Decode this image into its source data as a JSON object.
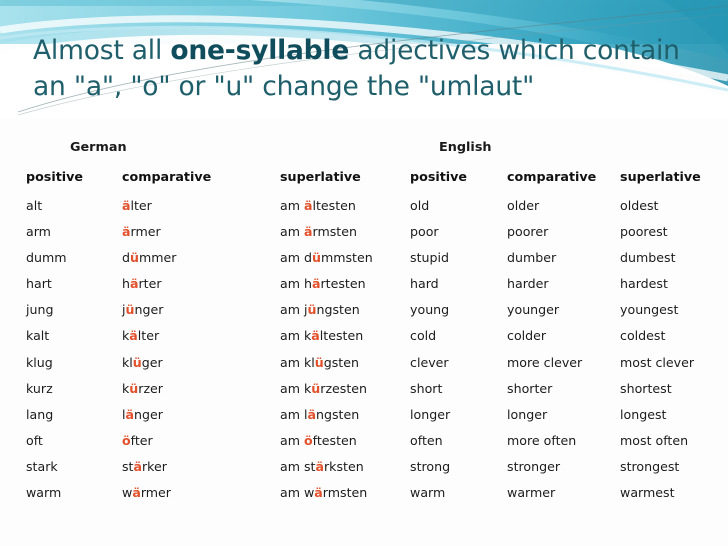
{
  "slide": {
    "title": {
      "line1_before": "Almost all ",
      "line1_strong": "one-syllable",
      "line1_after": " adjectives which contain",
      "line2": "an \"a\", \"o\" or \"u\" change the \"umlaut\""
    },
    "accent_color": "#1f5f6b",
    "umlaut_highlight_color": "#e2512b",
    "banner_colors": {
      "cyan_light": "#a8e1ec",
      "cyan_mid": "#5fc3d8",
      "teal": "#2e9fba",
      "white": "#ffffff"
    }
  },
  "table": {
    "group_headers": {
      "german": "German",
      "english": "English"
    },
    "columns": [
      "positive",
      "comparative",
      "superlative",
      "positive",
      "comparative",
      "superlative"
    ],
    "rows": [
      {
        "de_positive": "alt",
        "de_comparative": {
          "pre": "",
          "um": "ä",
          "post": "lter"
        },
        "de_superlative": {
          "pre": "am ",
          "um": "ä",
          "post": "ltesten"
        },
        "en_positive": "old",
        "en_comparative": "older",
        "en_superlative": "oldest"
      },
      {
        "de_positive": "arm",
        "de_comparative": {
          "pre": "",
          "um": "ä",
          "post": "rmer"
        },
        "de_superlative": {
          "pre": "am ",
          "um": "ä",
          "post": "rmsten"
        },
        "en_positive": "poor",
        "en_comparative": "poorer",
        "en_superlative": "poorest"
      },
      {
        "de_positive": "dumm",
        "de_comparative": {
          "pre": "d",
          "um": "ü",
          "post": "mmer"
        },
        "de_superlative": {
          "pre": "am d",
          "um": "ü",
          "post": "mmsten"
        },
        "en_positive": "stupid",
        "en_comparative": "dumber",
        "en_superlative": "dumbest"
      },
      {
        "de_positive": "hart",
        "de_comparative": {
          "pre": "h",
          "um": "ä",
          "post": "rter"
        },
        "de_superlative": {
          "pre": "am h",
          "um": "ä",
          "post": "rtesten"
        },
        "en_positive": "hard",
        "en_comparative": "harder",
        "en_superlative": "hardest"
      },
      {
        "de_positive": "jung",
        "de_comparative": {
          "pre": "j",
          "um": "ü",
          "post": "nger"
        },
        "de_superlative": {
          "pre": "am j",
          "um": "ü",
          "post": "ngsten"
        },
        "en_positive": "young",
        "en_comparative": "younger",
        "en_superlative": "youngest"
      },
      {
        "de_positive": "kalt",
        "de_comparative": {
          "pre": "k",
          "um": "ä",
          "post": "lter"
        },
        "de_superlative": {
          "pre": "am k",
          "um": "ä",
          "post": "ltesten"
        },
        "en_positive": "cold",
        "en_comparative": "colder",
        "en_superlative": "coldest"
      },
      {
        "de_positive": "klug",
        "de_comparative": {
          "pre": "kl",
          "um": "ü",
          "post": "ger"
        },
        "de_superlative": {
          "pre": "am kl",
          "um": "ü",
          "post": "gsten"
        },
        "en_positive": "clever",
        "en_comparative": "more clever",
        "en_superlative": "most clever"
      },
      {
        "de_positive": "kurz",
        "de_comparative": {
          "pre": "k",
          "um": "ü",
          "post": "rzer"
        },
        "de_superlative": {
          "pre": "am k",
          "um": "ü",
          "post": "rzesten"
        },
        "en_positive": "short",
        "en_comparative": "shorter",
        "en_superlative": "shortest"
      },
      {
        "de_positive": "lang",
        "de_comparative": {
          "pre": "l",
          "um": "ä",
          "post": "nger"
        },
        "de_superlative": {
          "pre": "am l",
          "um": "ä",
          "post": "ngsten"
        },
        "en_positive": "longer",
        "en_comparative": "longer",
        "en_superlative": "longest"
      },
      {
        "de_positive": "oft",
        "de_comparative": {
          "pre": "",
          "um": "ö",
          "post": "fter"
        },
        "de_superlative": {
          "pre": "am ",
          "um": "ö",
          "post": "ftesten"
        },
        "en_positive": "often",
        "en_comparative": "more often",
        "en_superlative": "most often"
      },
      {
        "de_positive": "stark",
        "de_comparative": {
          "pre": "st",
          "um": "ä",
          "post": "rker"
        },
        "de_superlative": {
          "pre": "am st",
          "um": "ä",
          "post": "rksten"
        },
        "en_positive": "strong",
        "en_comparative": "stronger",
        "en_superlative": "strongest"
      },
      {
        "de_positive": "warm",
        "de_comparative": {
          "pre": "w",
          "um": "ä",
          "post": "rmer"
        },
        "de_superlative": {
          "pre": "am w",
          "um": "ä",
          "post": "rmsten"
        },
        "en_positive": "warm",
        "en_comparative": "warmer",
        "en_superlative": "warmest"
      }
    ]
  }
}
